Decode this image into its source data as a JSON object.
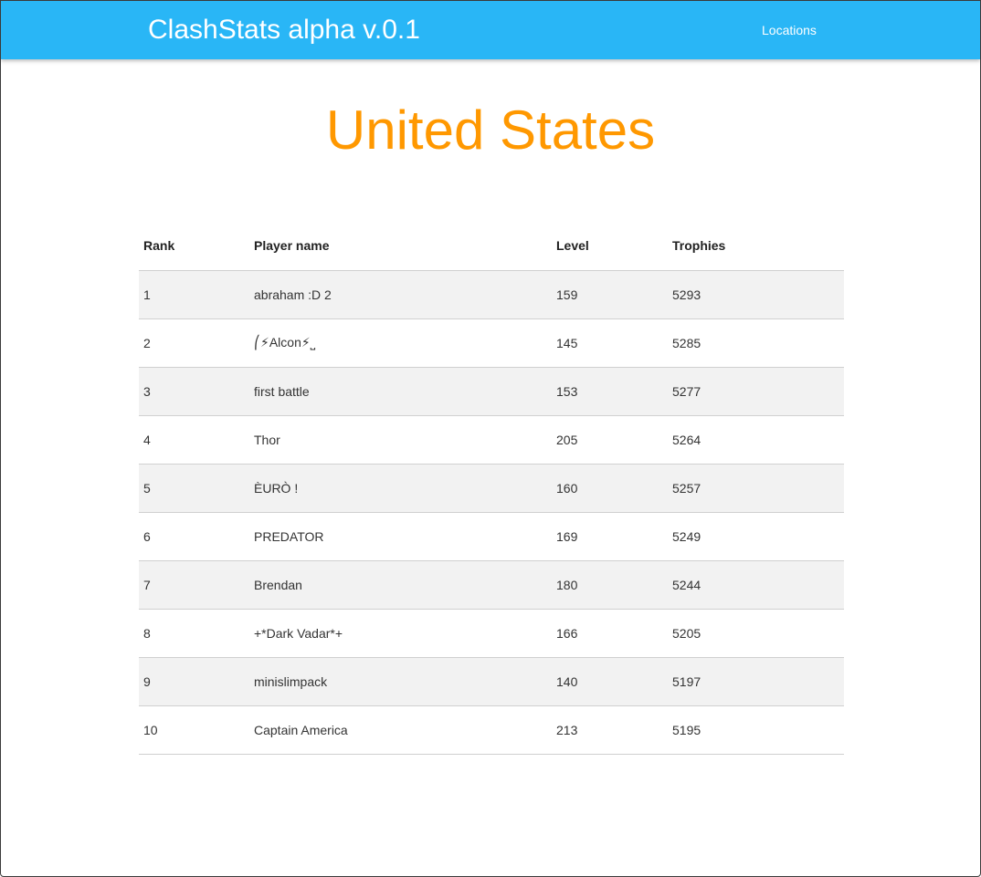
{
  "navbar": {
    "brand": "ClashStats alpha v.0.1",
    "locations_link": "Locations",
    "background_color": "#29b6f6"
  },
  "page": {
    "title": "United States",
    "title_color": "#ff9800"
  },
  "table": {
    "headers": {
      "rank": "Rank",
      "player_name": "Player name",
      "level": "Level",
      "trophies": "Trophies"
    },
    "rows": [
      {
        "rank": "1",
        "name": "abraham :D 2",
        "level": "159",
        "trophies": "5293"
      },
      {
        "rank": "2",
        "name": "⎛⚡Alcon⚡⎵",
        "level": "145",
        "trophies": "5285"
      },
      {
        "rank": "3",
        "name": "first battle",
        "level": "153",
        "trophies": "5277"
      },
      {
        "rank": "4",
        "name": "Thor",
        "level": "205",
        "trophies": "5264"
      },
      {
        "rank": "5",
        "name": "ÈURÒ !",
        "level": "160",
        "trophies": "5257"
      },
      {
        "rank": "6",
        "name": "PREDATOR",
        "level": "169",
        "trophies": "5249"
      },
      {
        "rank": "7",
        "name": "Brendan",
        "level": "180",
        "trophies": "5244"
      },
      {
        "rank": "8",
        "name": "+*Dark Vadar*+",
        "level": "166",
        "trophies": "5205"
      },
      {
        "rank": "9",
        "name": "minislimpack",
        "level": "140",
        "trophies": "5197"
      },
      {
        "rank": "10",
        "name": "Captain America",
        "level": "213",
        "trophies": "5195"
      }
    ]
  }
}
